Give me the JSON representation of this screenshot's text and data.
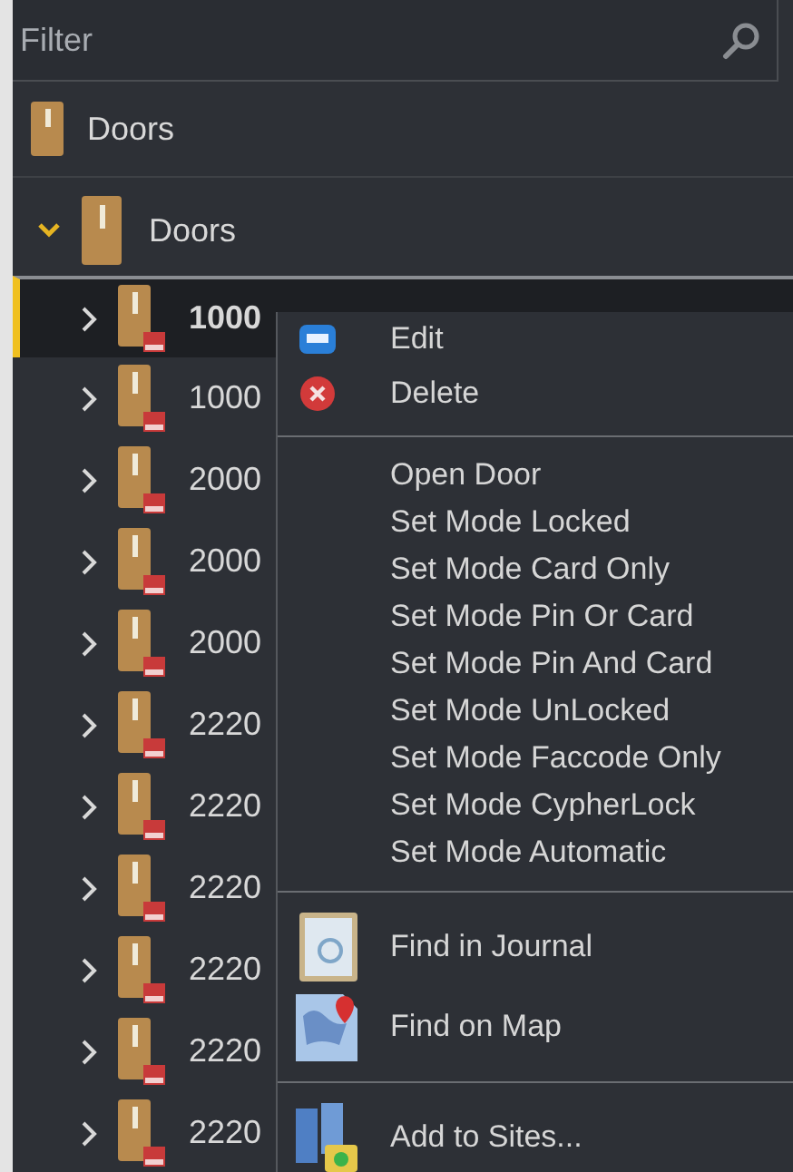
{
  "filter": {
    "placeholder": "Filter"
  },
  "header": {
    "label": "Doors"
  },
  "tree": {
    "label": "Doors",
    "expanded": true,
    "children": [
      {
        "label": "1000",
        "selected": true,
        "expanded": false
      },
      {
        "label": "1000",
        "selected": false,
        "expanded": false
      },
      {
        "label": "2000",
        "selected": false,
        "expanded": false
      },
      {
        "label": "2000",
        "selected": false,
        "expanded": false
      },
      {
        "label": "2000",
        "selected": false,
        "expanded": false
      },
      {
        "label": "2220",
        "selected": false,
        "expanded": false
      },
      {
        "label": "2220",
        "selected": false,
        "expanded": false
      },
      {
        "label": "2220",
        "selected": false,
        "expanded": false
      },
      {
        "label": "2220",
        "selected": false,
        "expanded": false
      },
      {
        "label": "2220",
        "selected": false,
        "expanded": false
      },
      {
        "label": "2220",
        "selected": false,
        "expanded": false
      }
    ]
  },
  "context_menu": {
    "items": [
      {
        "kind": "icon",
        "label": "Edit"
      },
      {
        "kind": "icon",
        "label": "Delete"
      },
      {
        "kind": "separator"
      },
      {
        "kind": "text",
        "label": "Open Door"
      },
      {
        "kind": "text",
        "label": "Set Mode Locked"
      },
      {
        "kind": "text",
        "label": "Set Mode Card Only"
      },
      {
        "kind": "text",
        "label": "Set Mode Pin Or Card"
      },
      {
        "kind": "text",
        "label": "Set Mode Pin And Card"
      },
      {
        "kind": "text",
        "label": "Set Mode UnLocked"
      },
      {
        "kind": "text",
        "label": "Set Mode Faccode Only"
      },
      {
        "kind": "text",
        "label": "Set Mode CypherLock"
      },
      {
        "kind": "text",
        "label": "Set Mode Automatic"
      },
      {
        "kind": "separator"
      },
      {
        "kind": "big",
        "label": "Find in Journal"
      },
      {
        "kind": "big",
        "label": "Find on Map"
      },
      {
        "kind": "separator"
      },
      {
        "kind": "big",
        "label": "Add to Sites..."
      }
    ]
  }
}
